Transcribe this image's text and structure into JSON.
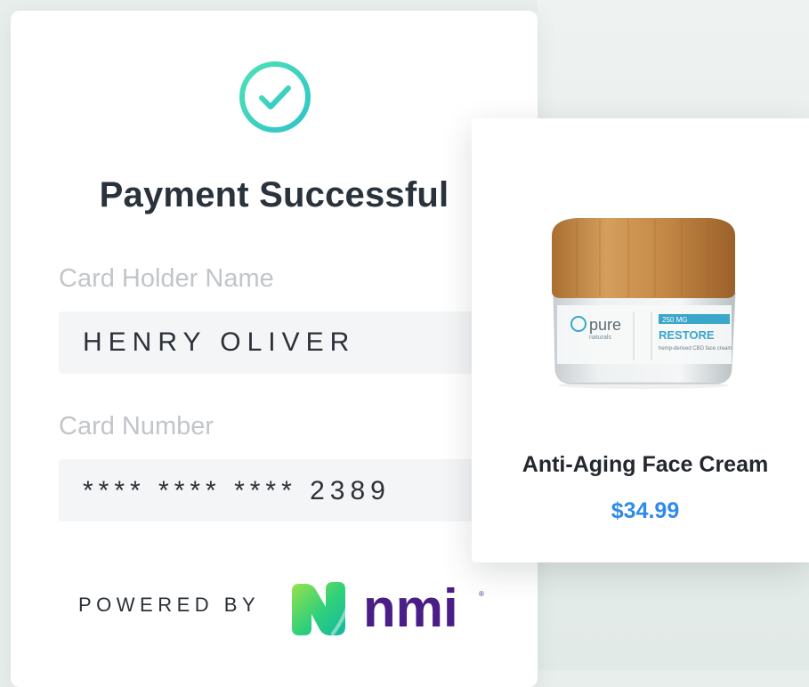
{
  "payment": {
    "title": "Payment Successful",
    "card_holder_label": "Card Holder Name",
    "card_holder_value": "HENRY OLIVER",
    "card_number_label": "Card Number",
    "card_number_value": "**** **** **** 2389",
    "powered_by": "POWERED BY",
    "brand_logo_text": "nmi",
    "success_icon": "check-circle-icon",
    "accent_color": "#3ed3b0"
  },
  "product": {
    "name": "Anti-Aging Face Cream",
    "price": "$34.99",
    "price_color": "#2f8ae8",
    "image_label": {
      "brand": "pure",
      "brand_sub": "naturals",
      "line": "RESTORE",
      "size": "250 MG",
      "desc": "hemp-derived CBD face cream"
    }
  }
}
